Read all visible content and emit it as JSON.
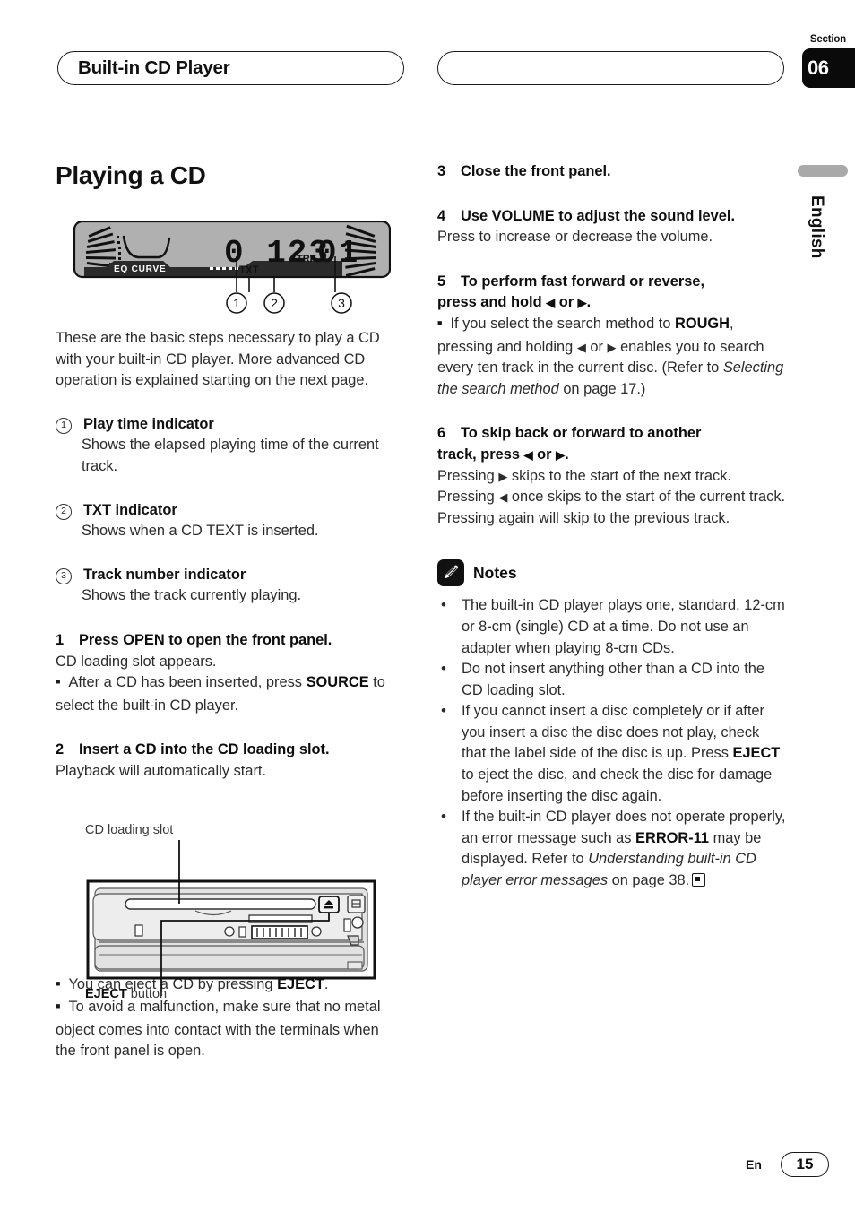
{
  "header": {
    "chapter_title": "Built-in CD Player",
    "section_label": "Section",
    "section_number": "06"
  },
  "margin": {
    "language": "English"
  },
  "page_title": "Playing a CD",
  "display_figure": {
    "eq_label": "EQ CURVE",
    "time_digits": "0 123",
    "trk_label": "TRK",
    "track_digits": "01",
    "txt_label": "TXT",
    "callouts": [
      "1",
      "2",
      "3"
    ]
  },
  "left_column": {
    "intro": "These are the basic steps necessary to play a CD with your built-in CD player. More advanced CD operation is explained starting on the next page.",
    "indicators": [
      {
        "num": "1",
        "title": "Play time indicator",
        "body": "Shows the elapsed playing time of the current track."
      },
      {
        "num": "2",
        "title": "TXT indicator",
        "body": "Shows when a CD TEXT is inserted."
      },
      {
        "num": "3",
        "title": "Track number indicator",
        "body": "Shows the track currently playing."
      }
    ],
    "step1": {
      "num": "1",
      "title": "Press OPEN to open the front panel.",
      "body": "CD loading slot appears.",
      "bullet_pre": "After a CD has been inserted, press ",
      "bullet_bold": "SOURCE",
      "bullet_post": " to select the built-in CD player."
    },
    "step2": {
      "num": "2",
      "title": "Insert a CD into the CD loading slot.",
      "body": "Playback will automatically start."
    },
    "unit_figure": {
      "slot_label": "CD loading slot",
      "eject_label_bold": "EJECT",
      "eject_label_rest": " button"
    },
    "bullets_after_figure": [
      {
        "pre": "You can eject a CD by pressing ",
        "bold": "EJECT",
        "post": "."
      },
      {
        "pre": "To avoid a malfunction, make sure that no metal object comes into contact with the terminals when the front panel is open.",
        "bold": "",
        "post": ""
      }
    ]
  },
  "right_column": {
    "step3": {
      "num": "3",
      "title": "Close the front panel."
    },
    "step4": {
      "num": "4",
      "title": "Use VOLUME to adjust the sound level.",
      "body": "Press to increase or decrease the volume."
    },
    "step5": {
      "num": "5",
      "title_line1": "To perform fast forward or reverse,",
      "title_line2_pre": "press and hold ",
      "title_left_arrow": "◀",
      "title_mid": " or ",
      "title_right_arrow": "▶",
      "title_line2_post": ".",
      "bullet_a": "If you select the search method to ",
      "bullet_bold": "ROUGH",
      "bullet_b": ", pressing and holding ",
      "bullet_c": " or ",
      "bullet_d": " enables you to search every ten track in the current disc. (Refer to ",
      "bullet_italic": "Selecting the search method",
      "bullet_e": " on page 17.)"
    },
    "step6": {
      "num": "6",
      "title_line1": "To skip back or forward to another",
      "title_line2_pre": "track, press ",
      "title_left_arrow": "◀",
      "title_mid": " or ",
      "title_right_arrow": "▶",
      "title_line2_post": ".",
      "body_a": "Pressing ",
      "body_b": " skips to the start of the next track. Pressing ",
      "body_c": " once skips to the start of the current track. Pressing again will skip to the previous track."
    },
    "notes": {
      "title": "Notes",
      "icon": "pencil-icon",
      "items": [
        {
          "text": "The built-in CD player plays one, standard, 12-cm or 8-cm (single) CD at a time. Do not use an adapter when playing 8-cm CDs."
        },
        {
          "text": "Do not insert anything other than a CD into the CD loading slot."
        },
        {
          "pre": "If you cannot insert a disc completely or if after you insert a disc the disc does not play, check that the label side of the disc is up. Press ",
          "bold": "EJECT",
          "post": " to eject the disc, and check the disc for damage before inserting the disc again."
        },
        {
          "pre": "If the built-in CD player does not operate properly, an error message such as ",
          "bold": "ERROR-11",
          "mid": " may be displayed. Refer to ",
          "italic": "Understanding built-in CD player error messages",
          "post": " on page 38.",
          "endmark": true
        }
      ]
    }
  },
  "footer": {
    "lang": "En",
    "page_number": "15"
  }
}
